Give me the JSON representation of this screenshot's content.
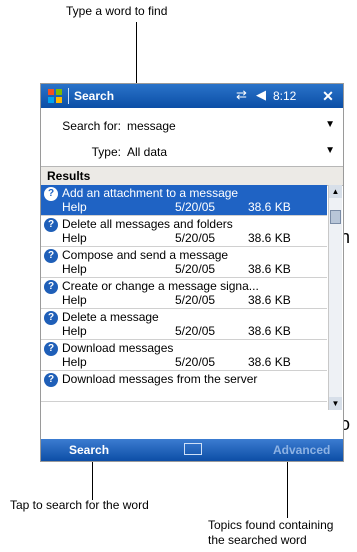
{
  "annotations": {
    "type_word": "Type a word to find",
    "tap_search": "Tap to search for the word",
    "topics_found_line1": "Topics found containing",
    "topics_found_line2": "the searched word"
  },
  "titlebar": {
    "title": "Search",
    "time": "8:12"
  },
  "form": {
    "search_label": "Search for:",
    "search_value": "message",
    "type_label": "Type:",
    "type_value": "All data"
  },
  "results": {
    "header": "Results",
    "items": [
      {
        "title": "Add an attachment to a message",
        "category": "Help",
        "date": "5/20/05",
        "size": "38.6 KB"
      },
      {
        "title": "Delete all messages and folders",
        "category": "Help",
        "date": "5/20/05",
        "size": "38.6 KB"
      },
      {
        "title": "Compose and send a message",
        "category": "Help",
        "date": "5/20/05",
        "size": "38.6 KB"
      },
      {
        "title": "Create or change a message signa...",
        "category": "Help",
        "date": "5/20/05",
        "size": "38.6 KB"
      },
      {
        "title": "Delete a message",
        "category": "Help",
        "date": "5/20/05",
        "size": "38.6 KB"
      },
      {
        "title": "Download messages",
        "category": "Help",
        "date": "5/20/05",
        "size": "38.6 KB"
      },
      {
        "title": "Download messages from the server",
        "category": "",
        "date": "",
        "size": ""
      }
    ]
  },
  "menubar": {
    "left": "Search",
    "right": "Advanced"
  }
}
